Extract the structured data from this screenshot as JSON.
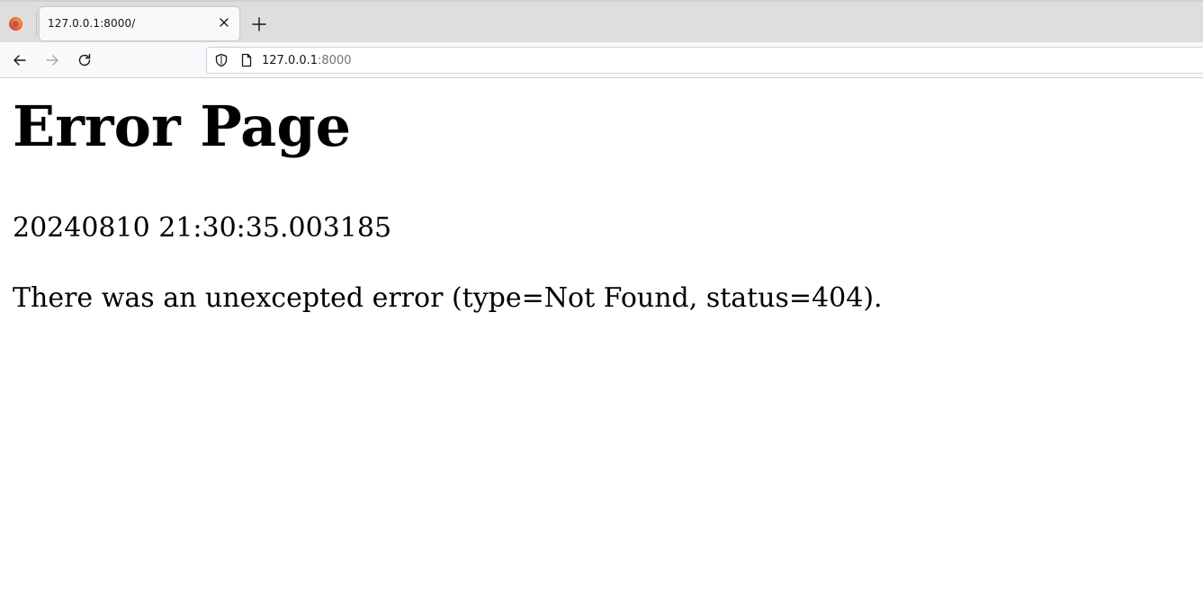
{
  "browser": {
    "tab": {
      "title": "127.0.0.1:8000/"
    },
    "urlbar": {
      "host": "127.0.0.1",
      "port": ":8000"
    },
    "icons": {
      "logo": "firefox-logo-icon",
      "tab_close": "close-icon",
      "new_tab": "plus-icon",
      "back": "arrow-left-icon",
      "forward": "arrow-right-icon",
      "reload": "reload-icon",
      "shield": "shield-icon",
      "page": "page-icon"
    }
  },
  "page": {
    "title": "Error Page",
    "timestamp": "20240810 21:30:35.003185",
    "message": "There was an unexcepted error (type=Not Found, status=404)."
  }
}
